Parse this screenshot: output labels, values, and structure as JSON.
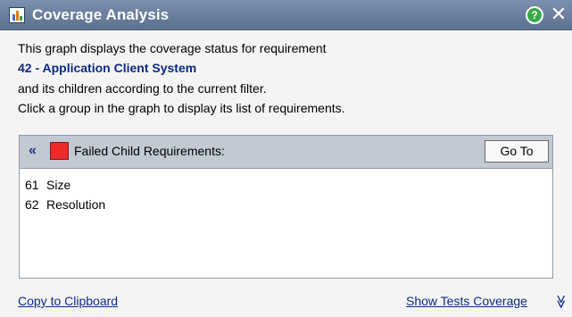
{
  "window": {
    "title": "Coverage Analysis",
    "help_icon": "help-circle-icon",
    "help_glyph": "?",
    "close_glyph": "✕"
  },
  "description": {
    "line1": "This graph displays the coverage status for requirement",
    "requirement": "42 - Application Client System",
    "line3": "and its children according to the current filter.",
    "line4": "Click a group in the graph to display its list of requirements."
  },
  "panel": {
    "collapse_glyph": "«",
    "status_color": "#ee2a2a",
    "title": "Failed Child Requirements:",
    "goto_label": "Go To",
    "requirements": [
      {
        "id": "61",
        "name": "Size"
      },
      {
        "id": "62",
        "name": "Resolution"
      }
    ]
  },
  "footer": {
    "copy_label": "Copy to Clipboard",
    "tests_label": "Show Tests Coverage",
    "expand_glyph": "≫"
  }
}
